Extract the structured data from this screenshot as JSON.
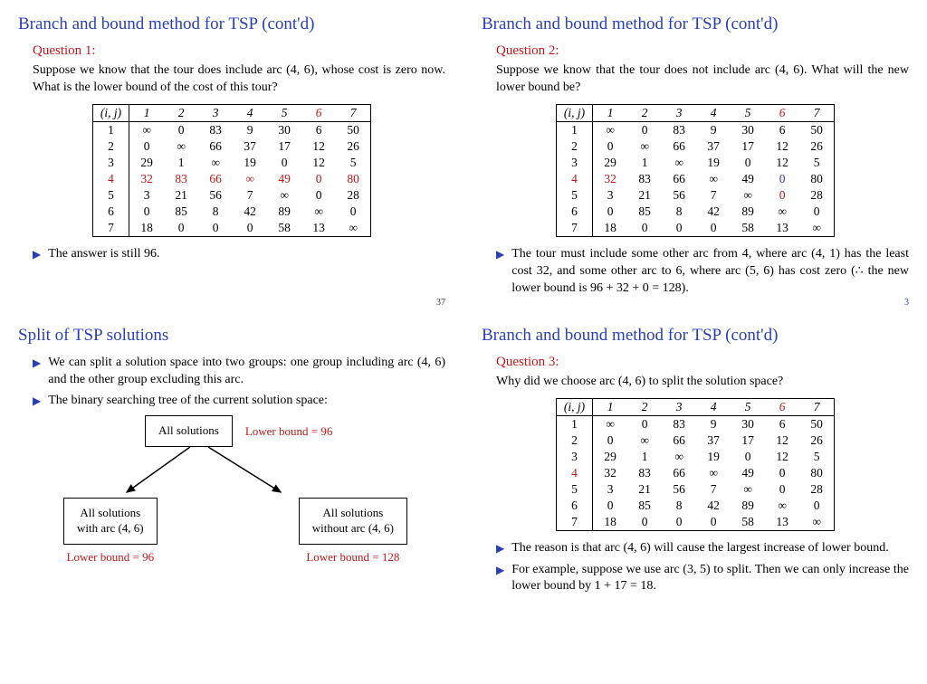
{
  "slides": {
    "tl": {
      "title": "Branch and bound method for TSP (cont'd)",
      "question_label": "Question 1:",
      "body": "Suppose we know that the tour does include arc (4, 6), whose cost is zero now. What is the lower bound of the cost of this tour?",
      "bullet1": "The answer is still 96.",
      "pagenum": "37",
      "table": {
        "header_label": "(i, j)",
        "cols": [
          "1",
          "2",
          "3",
          "4",
          "5",
          "6",
          "7"
        ],
        "highlight_col": "6",
        "highlight_row": "4",
        "rows": [
          {
            "label": "1",
            "cells": [
              "∞",
              "0",
              "83",
              "9",
              "30",
              "6",
              "50"
            ]
          },
          {
            "label": "2",
            "cells": [
              "0",
              "∞",
              "66",
              "37",
              "17",
              "12",
              "26"
            ]
          },
          {
            "label": "3",
            "cells": [
              "29",
              "1",
              "∞",
              "19",
              "0",
              "12",
              "5"
            ]
          },
          {
            "label": "4",
            "cells": [
              "32",
              "83",
              "66",
              "∞",
              "49",
              "0",
              "80"
            ],
            "highlight": true,
            "highlight_cell": "0"
          },
          {
            "label": "5",
            "cells": [
              "3",
              "21",
              "56",
              "7",
              "∞",
              "0",
              "28"
            ]
          },
          {
            "label": "6",
            "cells": [
              "0",
              "85",
              "8",
              "42",
              "89",
              "∞",
              "0"
            ]
          },
          {
            "label": "7",
            "cells": [
              "18",
              "0",
              "0",
              "0",
              "58",
              "13",
              "∞"
            ]
          }
        ]
      }
    },
    "tr": {
      "title": "Branch and bound method for TSP (cont'd)",
      "question_label": "Question 2:",
      "body": "Suppose we know that the tour does not include arc (4, 6). What will the new lower bound be?",
      "bullet1": "The tour must include some other arc from 4, where arc (4, 1) has the least cost 32, and some other arc to 6, where arc (5, 6) has cost zero (∴ the new lower bound is 96 + 32 + 0 = 128).",
      "pagenum": "3",
      "table": {
        "header_label": "(i, j)",
        "cols": [
          "1",
          "2",
          "3",
          "4",
          "5",
          "6",
          "7"
        ],
        "highlight_col": "6",
        "highlight_row": "4",
        "rows": [
          {
            "label": "1",
            "cells": [
              "∞",
              "0",
              "83",
              "9",
              "30",
              "6",
              "50"
            ]
          },
          {
            "label": "2",
            "cells": [
              "0",
              "∞",
              "66",
              "37",
              "17",
              "12",
              "26"
            ]
          },
          {
            "label": "3",
            "cells": [
              "29",
              "1",
              "∞",
              "19",
              "0",
              "12",
              "5"
            ]
          },
          {
            "label": "4",
            "cells": [
              "32",
              "83",
              "66",
              "∞",
              "49",
              "0",
              "80"
            ],
            "highlight": true,
            "highlight_cell": "0"
          },
          {
            "label": "5",
            "cells": [
              "3",
              "21",
              "56",
              "7",
              "∞",
              "0",
              "28"
            ],
            "highlight_cell": "0",
            "highlight_cell_index": 5
          },
          {
            "label": "6",
            "cells": [
              "0",
              "85",
              "8",
              "42",
              "89",
              "∞",
              "0"
            ]
          },
          {
            "label": "7",
            "cells": [
              "18",
              "0",
              "0",
              "0",
              "58",
              "13",
              "∞"
            ]
          }
        ]
      }
    },
    "bl": {
      "title": "Split of TSP solutions",
      "bullet1": "We can split a solution space into two groups: one group including arc (4, 6) and the other group excluding this arc.",
      "bullet2": "The binary searching tree of the current solution space:",
      "tree": {
        "root": "All solutions",
        "root_caption": "Lower bound = 96",
        "left_box_line1": "All solutions",
        "left_box_line2": "with arc (4, 6)",
        "left_caption": "Lower bound = 96",
        "right_box_line1": "All solutions",
        "right_box_line2": "without arc (4, 6)",
        "right_caption": "Lower bound = 128"
      }
    },
    "br": {
      "title": "Branch and bound method for TSP (cont'd)",
      "question_label": "Question 3:",
      "body": "Why did we choose arc (4, 6) to split the solution space?",
      "bullet1": "The reason is that arc (4, 6) will cause the largest increase of lower bound.",
      "bullet2": "For example, suppose we use arc (3, 5) to split. Then we can only increase the lower bound by 1 + 17 = 18.",
      "table": {
        "header_label": "(i, j)",
        "cols": [
          "1",
          "2",
          "3",
          "4",
          "5",
          "6",
          "7"
        ],
        "highlight_col": "6",
        "highlight_row": "4",
        "rows": [
          {
            "label": "1",
            "cells": [
              "∞",
              "0",
              "83",
              "9",
              "30",
              "6",
              "50"
            ]
          },
          {
            "label": "2",
            "cells": [
              "0",
              "∞",
              "66",
              "37",
              "17",
              "12",
              "26"
            ]
          },
          {
            "label": "3",
            "cells": [
              "29",
              "1",
              "∞",
              "19",
              "0",
              "12",
              "5"
            ]
          },
          {
            "label": "4",
            "cells": [
              "32",
              "83",
              "66",
              "∞",
              "49",
              "0",
              "80"
            ],
            "highlight": true
          },
          {
            "label": "5",
            "cells": [
              "3",
              "21",
              "56",
              "7",
              "∞",
              "0",
              "28"
            ]
          },
          {
            "label": "6",
            "cells": [
              "0",
              "85",
              "8",
              "42",
              "89",
              "∞",
              "0"
            ]
          },
          {
            "label": "7",
            "cells": [
              "18",
              "0",
              "0",
              "0",
              "58",
              "13",
              "∞"
            ]
          }
        ]
      }
    }
  }
}
